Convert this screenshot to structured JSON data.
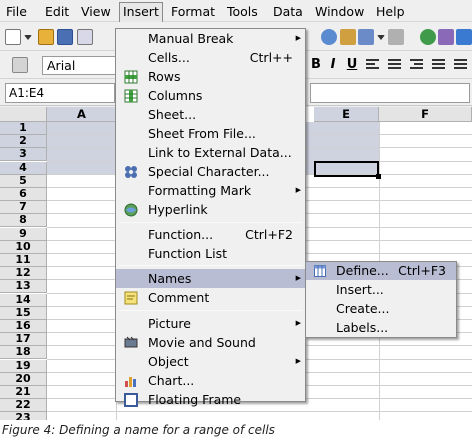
{
  "menubar": {
    "items": [
      "File",
      "Edit",
      "View",
      "Insert",
      "Format",
      "Tools",
      "Data",
      "Window",
      "Help"
    ],
    "active": "Insert"
  },
  "formatting": {
    "font_name": "Arial"
  },
  "formula_bar": {
    "name_box": "A1:E4"
  },
  "grid": {
    "columns": [
      "A",
      "E",
      "F"
    ],
    "rows": [
      "1",
      "2",
      "3",
      "4",
      "5",
      "6",
      "7",
      "8",
      "9",
      "10",
      "11",
      "12",
      "13",
      "14",
      "15",
      "16",
      "17",
      "18",
      "19",
      "20",
      "21",
      "22",
      "23"
    ],
    "selected_rows": 4
  },
  "insert_menu": {
    "items": [
      {
        "label": "Manual Break",
        "shortcut": "",
        "submenu": true,
        "icon": ""
      },
      {
        "label": "Cells...",
        "shortcut": "Ctrl++",
        "submenu": false,
        "icon": ""
      },
      {
        "label": "Rows",
        "shortcut": "",
        "submenu": false,
        "icon": "rows-icon"
      },
      {
        "label": "Columns",
        "shortcut": "",
        "submenu": false,
        "icon": "columns-icon"
      },
      {
        "label": "Sheet...",
        "shortcut": "",
        "submenu": false,
        "icon": ""
      },
      {
        "label": "Sheet From File...",
        "shortcut": "",
        "submenu": false,
        "icon": ""
      },
      {
        "label": "Link to External Data...",
        "shortcut": "",
        "submenu": false,
        "icon": ""
      },
      {
        "label": "Special Character...",
        "shortcut": "",
        "submenu": false,
        "icon": "special-character-icon"
      },
      {
        "label": "Formatting Mark",
        "shortcut": "",
        "submenu": true,
        "icon": ""
      },
      {
        "label": "Hyperlink",
        "shortcut": "",
        "submenu": false,
        "icon": "hyperlink-icon"
      },
      {
        "label": "Function...",
        "shortcut": "Ctrl+F2",
        "submenu": false,
        "icon": ""
      },
      {
        "label": "Function List",
        "shortcut": "",
        "submenu": false,
        "icon": ""
      },
      {
        "label": "Names",
        "shortcut": "",
        "submenu": true,
        "icon": "",
        "highlighted": true
      },
      {
        "label": "Comment",
        "shortcut": "",
        "submenu": false,
        "icon": "comment-icon"
      },
      {
        "label": "Picture",
        "shortcut": "",
        "submenu": true,
        "icon": ""
      },
      {
        "label": "Movie and Sound",
        "shortcut": "",
        "submenu": false,
        "icon": "movie-icon"
      },
      {
        "label": "Object",
        "shortcut": "",
        "submenu": true,
        "icon": ""
      },
      {
        "label": "Chart...",
        "shortcut": "",
        "submenu": false,
        "icon": "chart-icon"
      },
      {
        "label": "Floating Frame",
        "shortcut": "",
        "submenu": false,
        "icon": "frame-icon"
      }
    ]
  },
  "names_submenu": {
    "items": [
      {
        "label": "Define...",
        "shortcut": "Ctrl+F3",
        "highlighted": true
      },
      {
        "label": "Insert...",
        "shortcut": ""
      },
      {
        "label": "Create...",
        "shortcut": ""
      },
      {
        "label": "Labels...",
        "shortcut": ""
      }
    ]
  },
  "caption": "Figure 4: Defining a name for a range of cells"
}
